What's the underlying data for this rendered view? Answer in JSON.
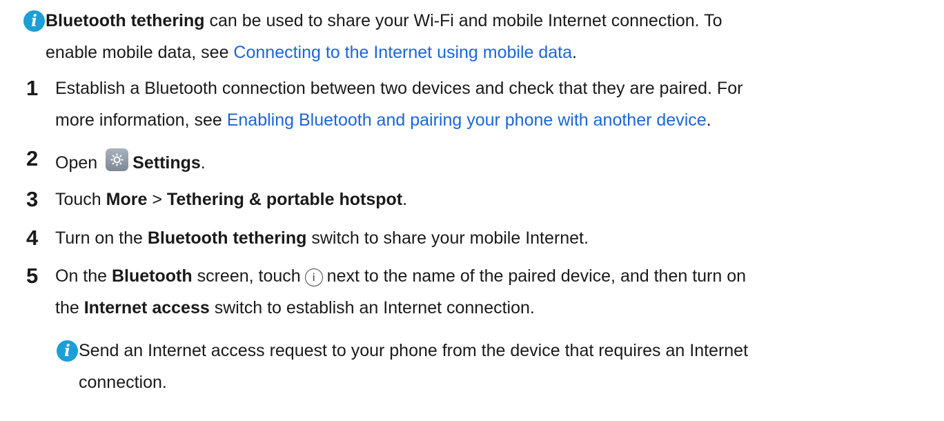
{
  "note1": {
    "bold": "Bluetooth tethering",
    "line1_rest": " can be used to share your Wi-Fi and mobile Internet connection. To",
    "line2_pre": "enable mobile data, see ",
    "link": "Connecting to the Internet using mobile data",
    "line2_post": "."
  },
  "steps": [
    {
      "num": "1",
      "line1": "Establish a Bluetooth connection between two devices and check that they are paired. For",
      "line2_pre": "more information, see ",
      "link": "Enabling Bluetooth and pairing your phone with another device",
      "line2_post": "."
    },
    {
      "num": "2",
      "pre": "Open",
      "icon": "settings-icon",
      "bold": "Settings",
      "post": "."
    },
    {
      "num": "3",
      "pre": "Touch ",
      "bold1": "More",
      "sep": " > ",
      "bold2": "Tethering & portable hotspot",
      "post": "."
    },
    {
      "num": "4",
      "pre": "Turn on the ",
      "bold": "Bluetooth tethering",
      "post": " switch to share your mobile Internet."
    },
    {
      "num": "5",
      "pre": "On the ",
      "bold": "Bluetooth",
      "mid": " screen, touch",
      "icon": "info-icon",
      "icon_glyph": "i",
      "post": "next to the name of the paired device, and then turn on",
      "line2_pre": "the ",
      "line2_bold": "Internet access",
      "line2_post": " switch to establish an Internet connection."
    }
  ],
  "note2": {
    "line1": "Send an Internet access request to your phone from the device that requires an Internet",
    "line2": "connection."
  },
  "colors": {
    "link": "#1a66d8",
    "note_icon": "#1b9fd7",
    "text": "#1a1a1a"
  }
}
